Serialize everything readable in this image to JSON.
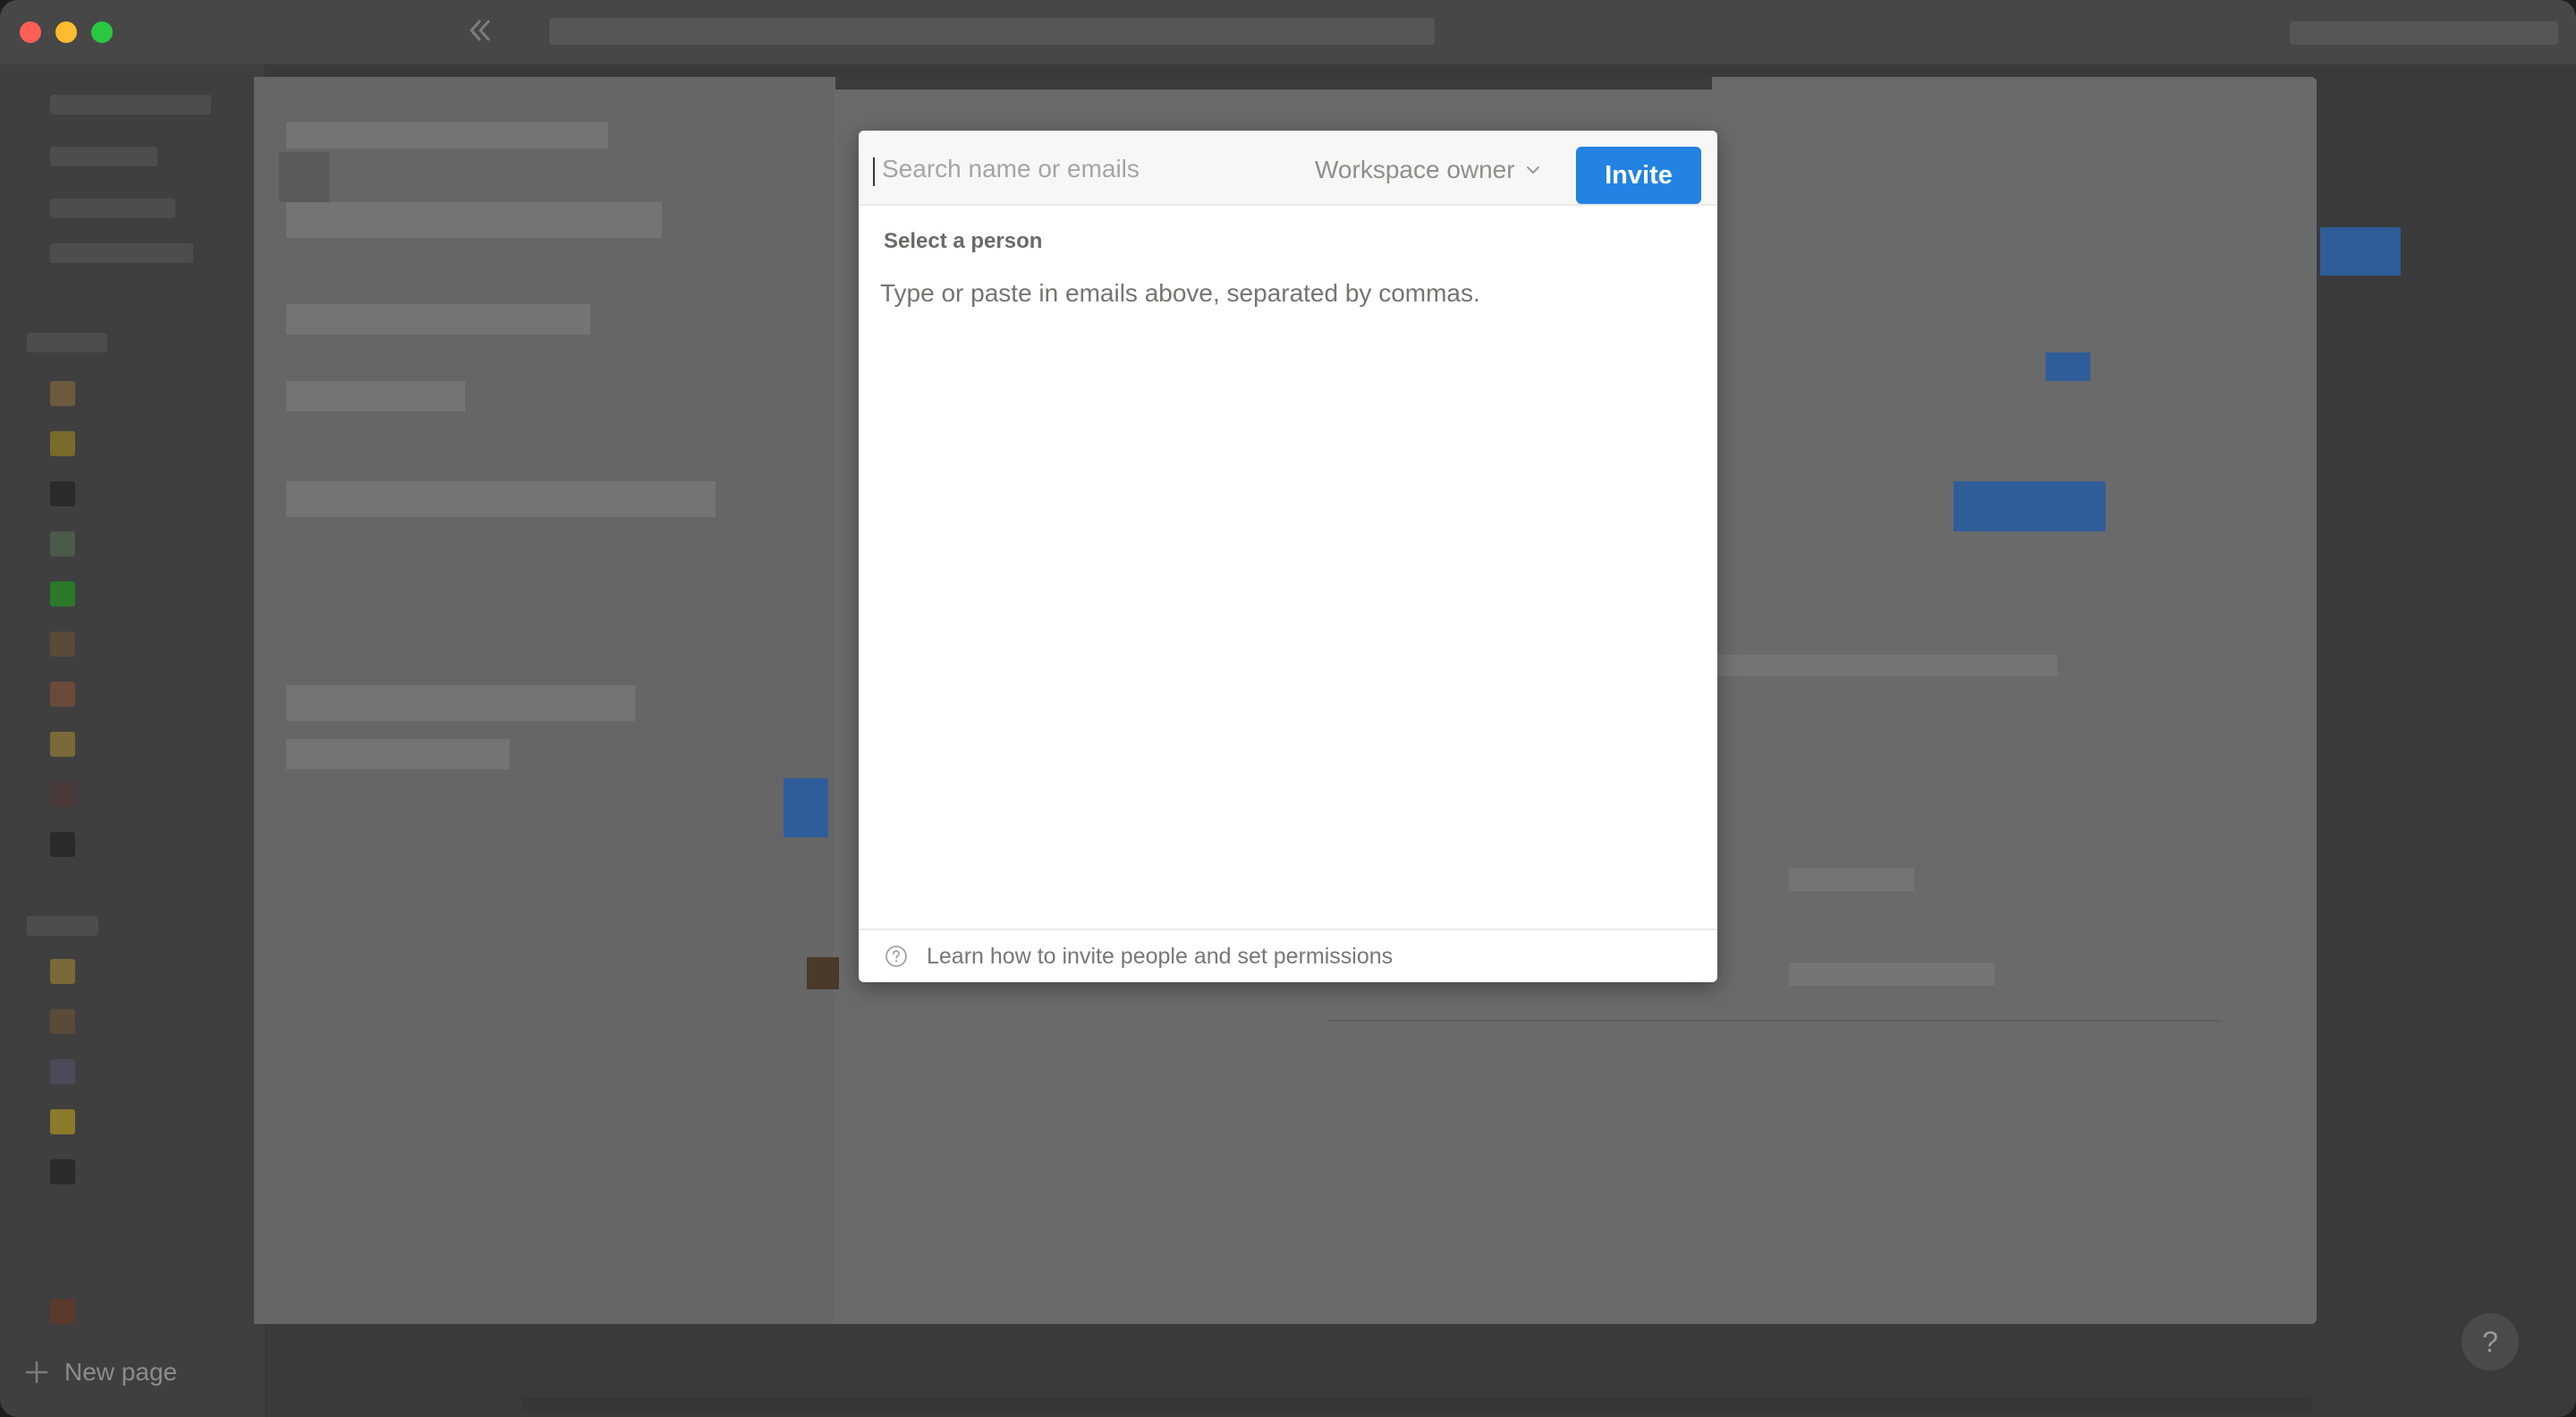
{
  "sidebar": {
    "new_page_label": "New page"
  },
  "modal": {
    "search": {
      "placeholder": "Search name or emails",
      "value": ""
    },
    "role_select": {
      "selected": "Workspace owner"
    },
    "invite_button_label": "Invite",
    "section_label": "Select a person",
    "hint": "Type or paste in emails above, separated by commas.",
    "footer_link": "Learn how to invite people and set permissions"
  },
  "help_button_label": "?",
  "colors": {
    "accent": "#2383e2",
    "close": "#ff5f57",
    "minimize": "#febc2e",
    "zoom": "#28c840"
  }
}
